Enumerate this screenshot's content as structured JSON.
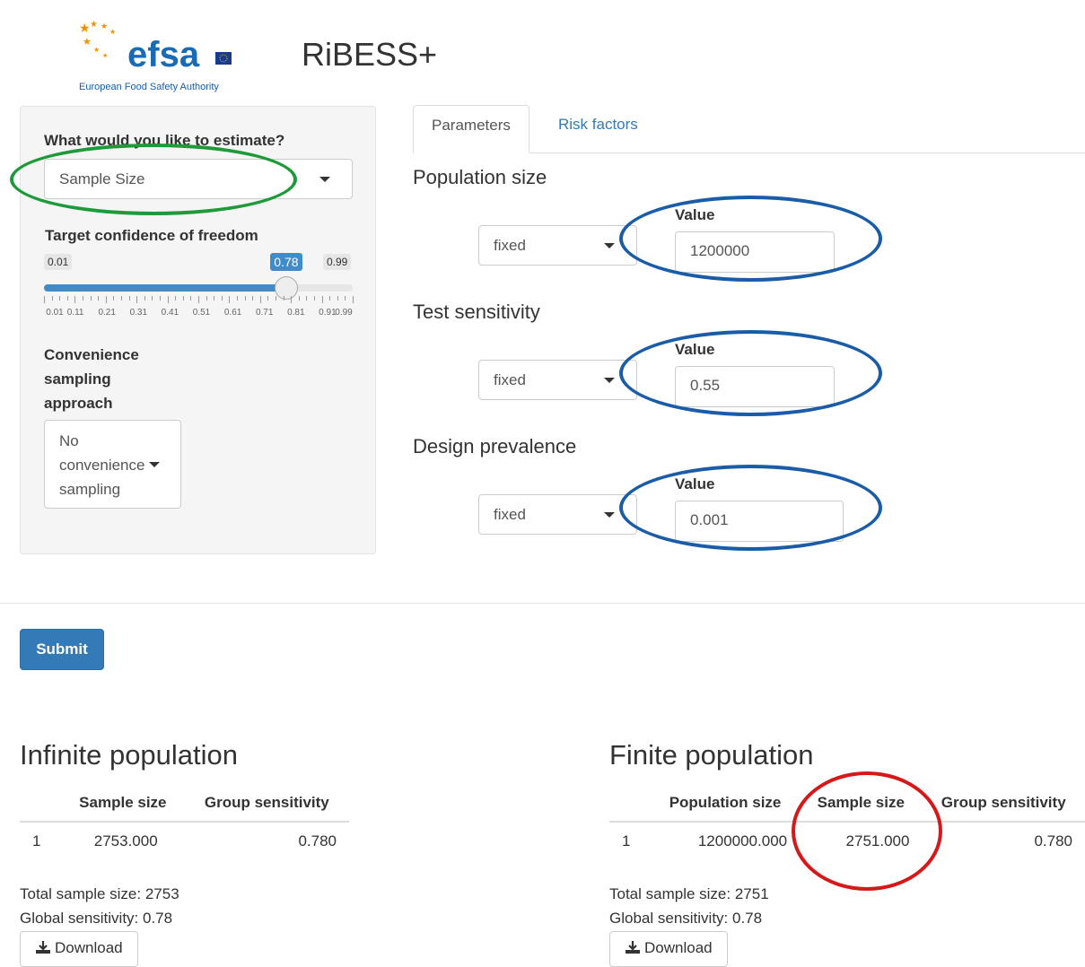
{
  "header": {
    "logo_word": "efsa",
    "logo_caption": "European Food Safety Authority",
    "app_title": "RiBESS+"
  },
  "sidebar": {
    "estimate_label": "What would you like to estimate?",
    "estimate_value": "Sample Size",
    "confidence_label": "Target confidence of freedom",
    "slider": {
      "min_label": "0.01",
      "max_label": "0.99",
      "value_label": "0.78",
      "value": 0.78,
      "min": 0.01,
      "max": 0.99,
      "ticks": [
        "0.01",
        "0.11",
        "0.21",
        "0.31",
        "0.41",
        "0.51",
        "0.61",
        "0.71",
        "0.81",
        "0.91",
        "0.99"
      ]
    },
    "convenience_label_1": "Convenience",
    "convenience_label_2": "sampling",
    "convenience_label_3": "approach",
    "convenience_value_1": "No",
    "convenience_value_2": "convenience",
    "convenience_value_3": "sampling"
  },
  "tabs": {
    "parameters": "Parameters",
    "risk_factors": "Risk factors"
  },
  "params": {
    "population_size": {
      "heading": "Population size",
      "mode": "fixed",
      "value_label": "Value",
      "value": "1200000"
    },
    "test_sensitivity": {
      "heading": "Test sensitivity",
      "mode": "fixed",
      "value_label": "Value",
      "value": "0.55"
    },
    "design_prevalence": {
      "heading": "Design prevalence",
      "mode": "fixed",
      "value_label": "Value",
      "value": "0.001"
    }
  },
  "submit_label": "Submit",
  "infinite": {
    "heading": "Infinite population",
    "columns": [
      "",
      "Sample size",
      "Group sensitivity"
    ],
    "row": [
      "1",
      "2753.000",
      "0.780"
    ],
    "total_sample": "Total sample size: 2753",
    "global_sensitivity": "Global sensitivity: 0.78",
    "download_label": "Download"
  },
  "finite": {
    "heading": "Finite population",
    "columns": [
      "",
      "Population size",
      "Sample size",
      "Group sensitivity"
    ],
    "row": [
      "1",
      "1200000.000",
      "2751.000",
      "0.780"
    ],
    "total_sample": "Total sample size: 2751",
    "global_sensitivity": "Global sensitivity: 0.78",
    "download_label": "Download"
  },
  "colors": {
    "primary": "#337ab7",
    "highlight_green": "#1e9a3a",
    "highlight_blue": "#1a5ca8",
    "highlight_red": "#d81818",
    "efsa_blue": "#1a6bb5",
    "efsa_orange": "#f29100"
  }
}
